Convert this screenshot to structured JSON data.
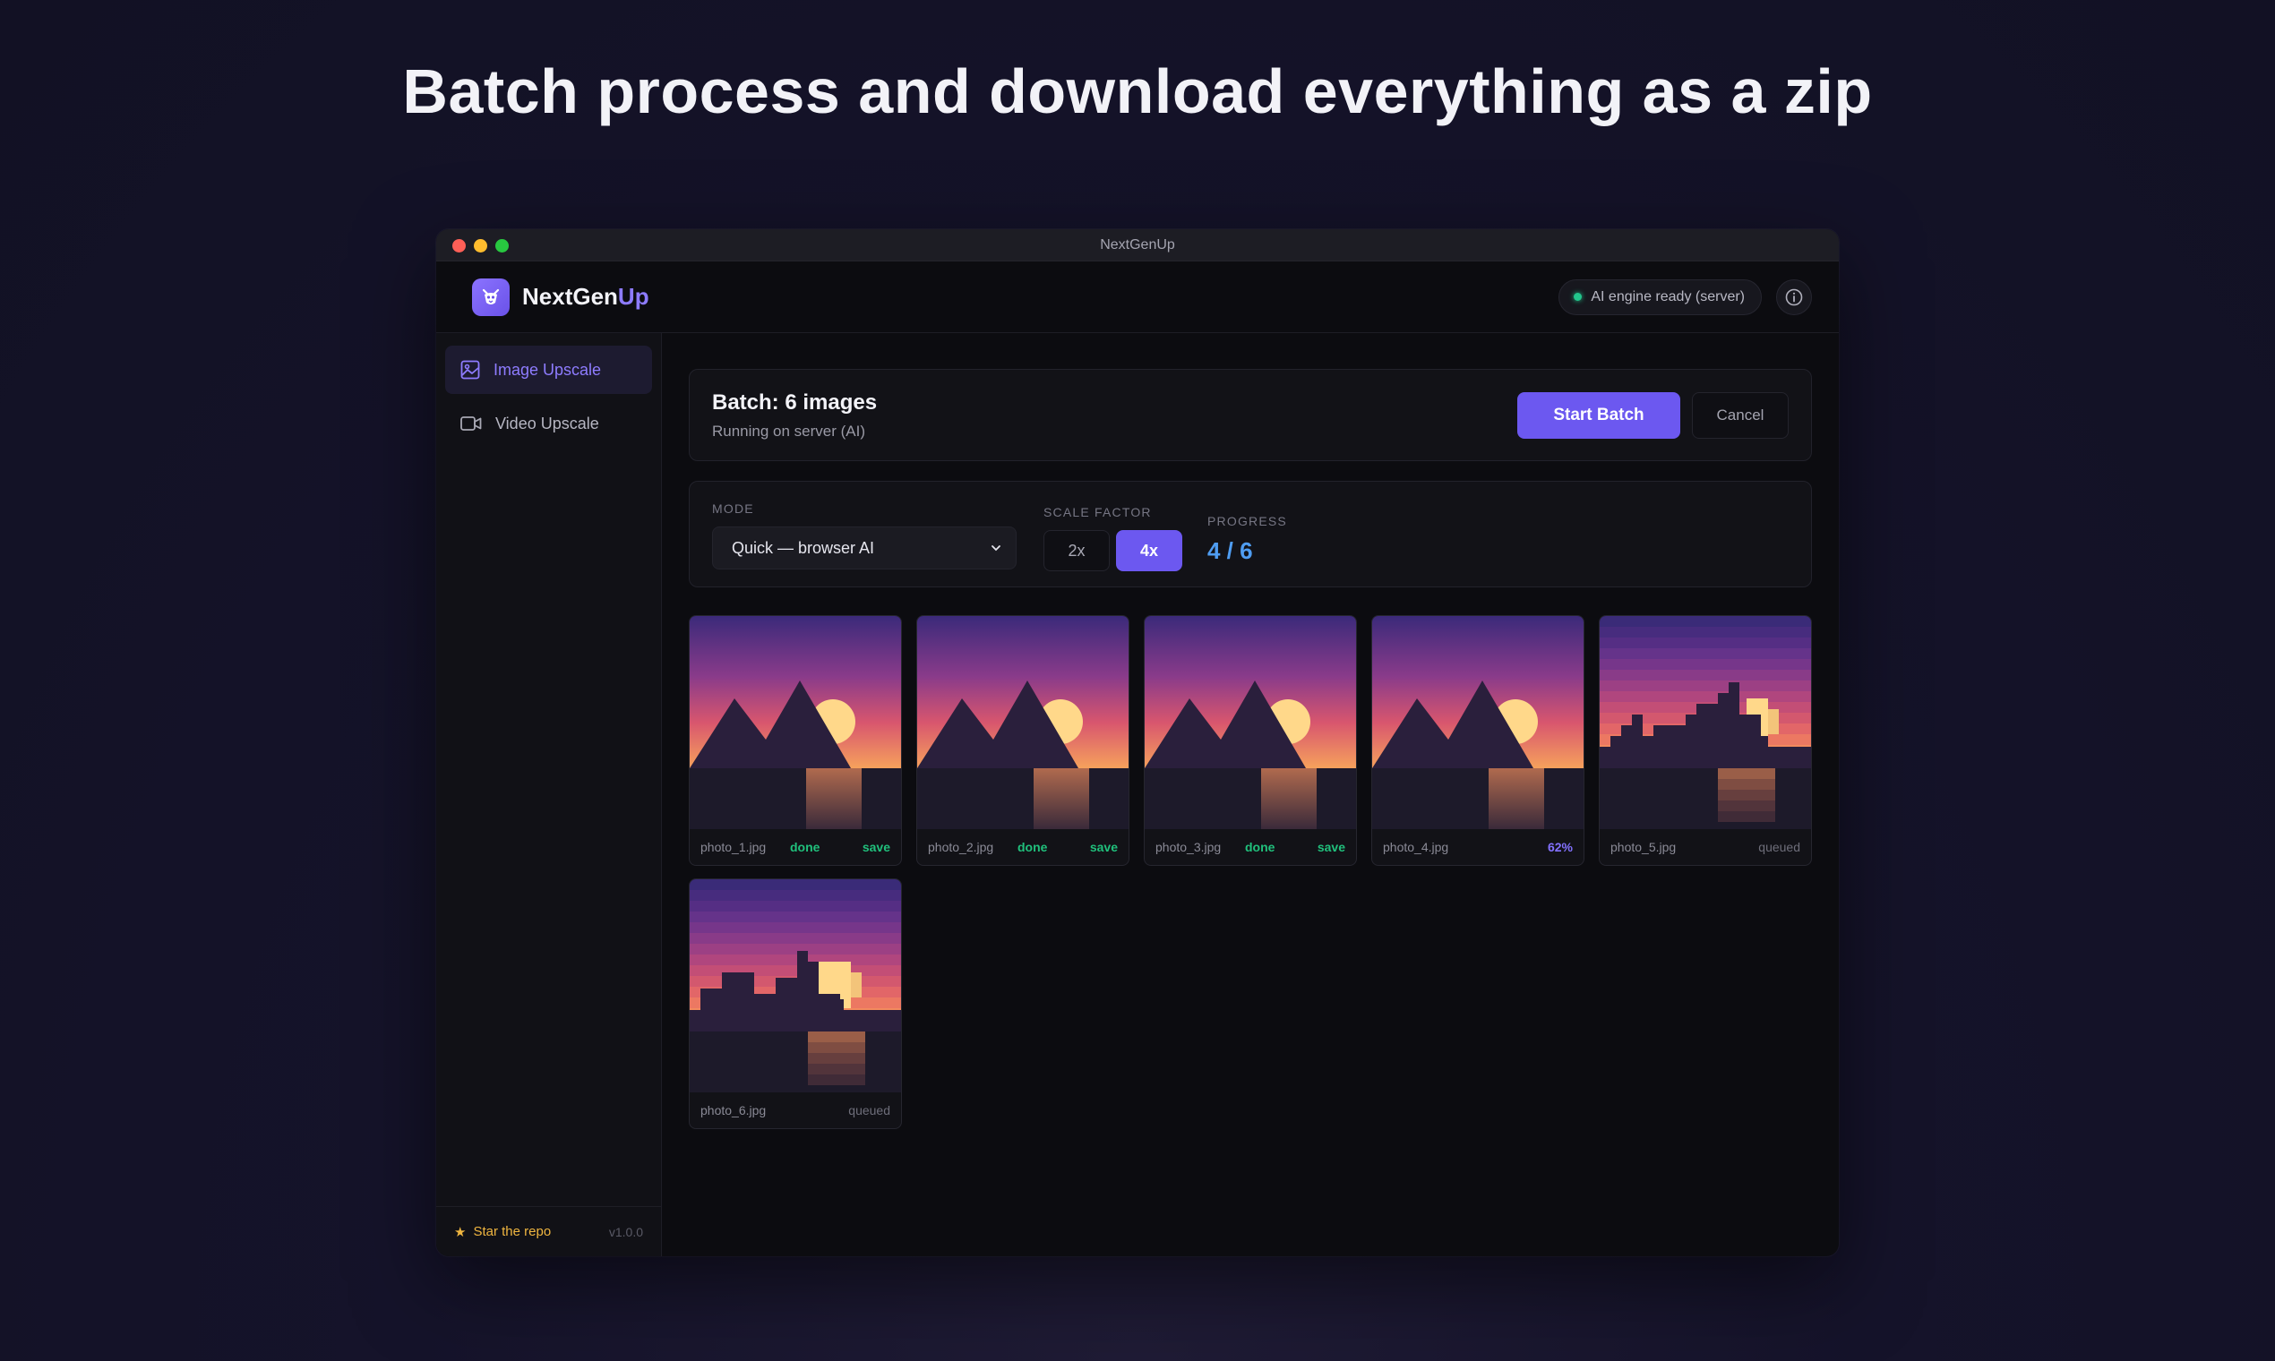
{
  "headline": "Batch process and download everything as a zip",
  "window": {
    "title": "NextGenUp"
  },
  "brand": {
    "name_main": "NextGen",
    "name_accent": "Up"
  },
  "header": {
    "engine_status": "AI engine ready (server)"
  },
  "sidebar": {
    "items": [
      {
        "label": "Image Upscale",
        "icon": "image-icon",
        "active": true
      },
      {
        "label": "Video Upscale",
        "icon": "video-icon",
        "active": false
      }
    ],
    "star_label": "Star the repo",
    "version": "v1.0.0"
  },
  "batch": {
    "title": "Batch: 6 images",
    "subtitle": "Running on server (AI)",
    "start_label": "Start Batch",
    "cancel_label": "Cancel"
  },
  "settings": {
    "mode_label": "MODE",
    "mode_value": "Quick — browser AI",
    "scale_label": "SCALE FACTOR",
    "scale_options": [
      "2x",
      "4x"
    ],
    "scale_selected": "4x",
    "progress_label": "PROGRESS",
    "progress_value": "4 / 6"
  },
  "images": [
    {
      "name": "photo_1.jpg",
      "status": "done",
      "action": "save"
    },
    {
      "name": "photo_2.jpg",
      "status": "done",
      "action": "save"
    },
    {
      "name": "photo_3.jpg",
      "status": "done",
      "action": "save"
    },
    {
      "name": "photo_4.jpg",
      "status": "62%",
      "action": ""
    },
    {
      "name": "photo_5.jpg",
      "status": "queued",
      "action": ""
    },
    {
      "name": "photo_6.jpg",
      "status": "queued",
      "action": ""
    }
  ],
  "colors": {
    "accent": "#6c58f0",
    "success": "#20c07c",
    "progress": "#4f9df2",
    "star": "#f0b640"
  }
}
